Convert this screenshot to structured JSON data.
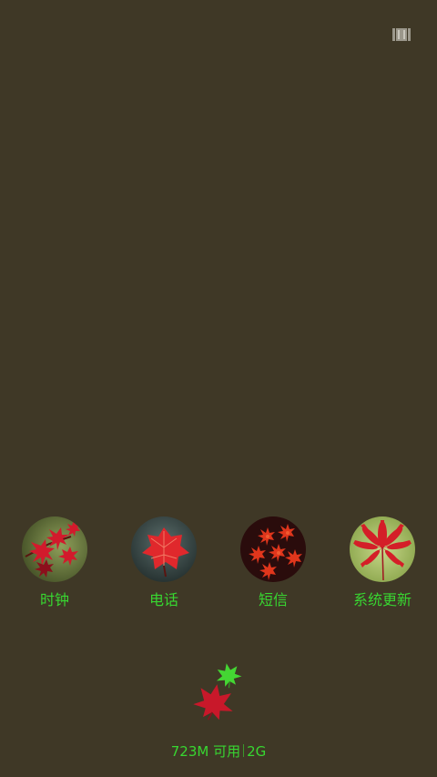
{
  "menu": {
    "icon": "menu-bars-icon"
  },
  "apps": [
    {
      "label": "时钟",
      "icon": "red-maple-branch-icon"
    },
    {
      "label": "电话",
      "icon": "red-leaf-icon"
    },
    {
      "label": "短信",
      "icon": "red-maple-cluster-icon"
    },
    {
      "label": "系统更新",
      "icon": "red-maple-leaf-icon"
    }
  ],
  "leaf_toggle": {
    "icon": "maple-leaves-icon"
  },
  "status": {
    "memory": "723M 可用",
    "total": "2G"
  },
  "colors": {
    "background": "#3f3826",
    "label_green": "#38d631",
    "leaf_red": "#c8182a",
    "leaf_green": "#44d633"
  }
}
